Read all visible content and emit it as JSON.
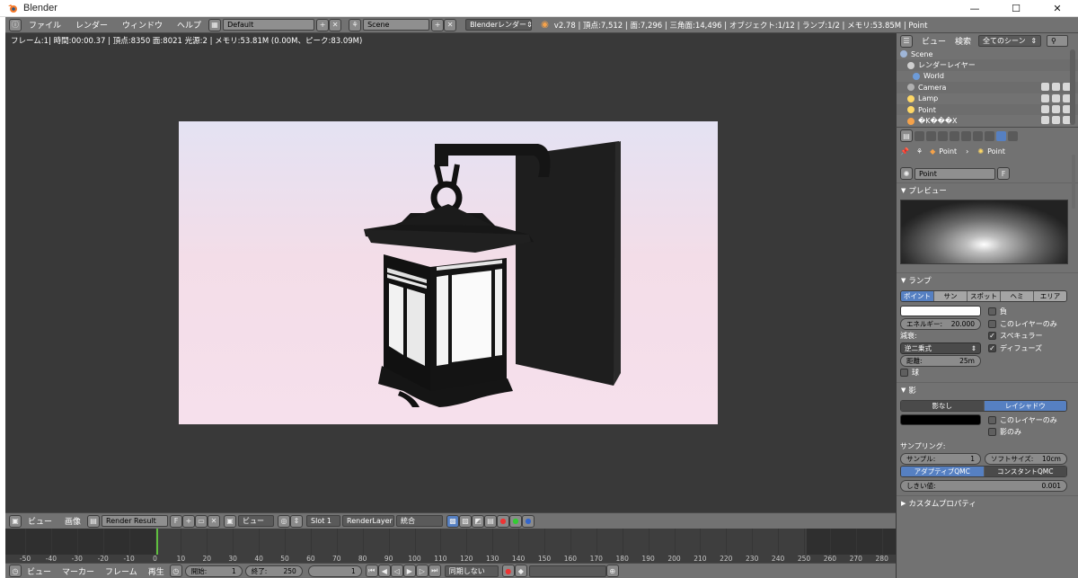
{
  "window": {
    "title": "Blender",
    "controls": [
      "—",
      "☐",
      "✕"
    ]
  },
  "topbar": {
    "menus": [
      "ファイル",
      "レンダー",
      "ウィンドウ",
      "ヘルプ"
    ],
    "layout": "Default",
    "scene": "Scene",
    "engine": "Blenderレンダー",
    "stats": "v2.78 | 頂点:7,512 | 面:7,296 | 三角面:14,496 | オブジェクト:1/12 | ランプ:1/2 | メモリ:53.85M | Point"
  },
  "viewport": {
    "info": "フレーム:1| 時間:00:00.37 | 頂点:8350 面:8021 光源:2 | メモリ:53.81M (0.00M、ピーク:83.09M)"
  },
  "image_editor": {
    "menus": [
      "ビュー",
      "画像"
    ],
    "image_name": "Render Result",
    "fake_user": "F",
    "view": "ビュー",
    "slot": "Slot 1",
    "layer": "RenderLayer",
    "pass": "統合"
  },
  "timeline": {
    "ticks": [
      "-50",
      "-40",
      "-30",
      "-20",
      "-10",
      "0",
      "10",
      "20",
      "30",
      "40",
      "50",
      "60",
      "70",
      "80",
      "90",
      "100",
      "110",
      "120",
      "130",
      "140",
      "150",
      "160",
      "170",
      "180",
      "190",
      "200",
      "210",
      "220",
      "230",
      "240",
      "250",
      "260",
      "270",
      "280"
    ],
    "menus": [
      "ビュー",
      "マーカー",
      "フレーム",
      "再生"
    ],
    "start_label": "開始:",
    "start": "1",
    "end_label": "終了:",
    "end": "250",
    "current": "1",
    "sync": "同期しない"
  },
  "outliner": {
    "menus": [
      "ビュー",
      "検索"
    ],
    "filter": "全てのシーン",
    "items": [
      {
        "name": "Scene",
        "icon": "scene-icon"
      },
      {
        "name": "レンダーレイヤー",
        "icon": "renderlayer-icon"
      },
      {
        "name": "World",
        "icon": "world-icon"
      },
      {
        "name": "Camera",
        "icon": "camera-icon"
      },
      {
        "name": "Lamp",
        "icon": "lamp-icon"
      },
      {
        "name": "Point",
        "icon": "lamp-icon"
      },
      {
        "name": "�K���X",
        "icon": "mesh-icon"
      }
    ]
  },
  "properties": {
    "breadcrumb": [
      "Point",
      "Point"
    ],
    "datablock": "Point",
    "fake_user": "F",
    "preview_title": "プレビュー",
    "lamp_title": "ランプ",
    "lamp_types": [
      "ポイント",
      "サン",
      "スポット",
      "ヘミ",
      "エリア"
    ],
    "lamp_options": [
      "負",
      "このレイヤーのみ",
      "スペキュラー",
      "ディフューズ"
    ],
    "energy_label": "エネルギー:",
    "energy": "20.000",
    "falloff_label": "減衰:",
    "falloff": "逆二乗式",
    "distance_label": "距離:",
    "distance": "25m",
    "sphere": "球",
    "shadow_title": "影",
    "shadow_types": [
      "影なし",
      "レイシャドウ"
    ],
    "shadow_options": [
      "このレイヤーのみ",
      "影のみ"
    ],
    "sampling_label": "サンプリング:",
    "samples_label": "サンプル:",
    "samples": "1",
    "soft_label": "ソフトサイズ:",
    "soft": "10cm",
    "qmc": [
      "アダプティブQMC",
      "コンスタントQMC"
    ],
    "threshold_label": "しきい値:",
    "threshold": "0.001",
    "custom_props": "カスタムプロパティ"
  },
  "colors": {
    "accent": "#5680c2",
    "header": "#727272",
    "viewport": "#393939",
    "frame_marker": "#5fbf3f"
  }
}
